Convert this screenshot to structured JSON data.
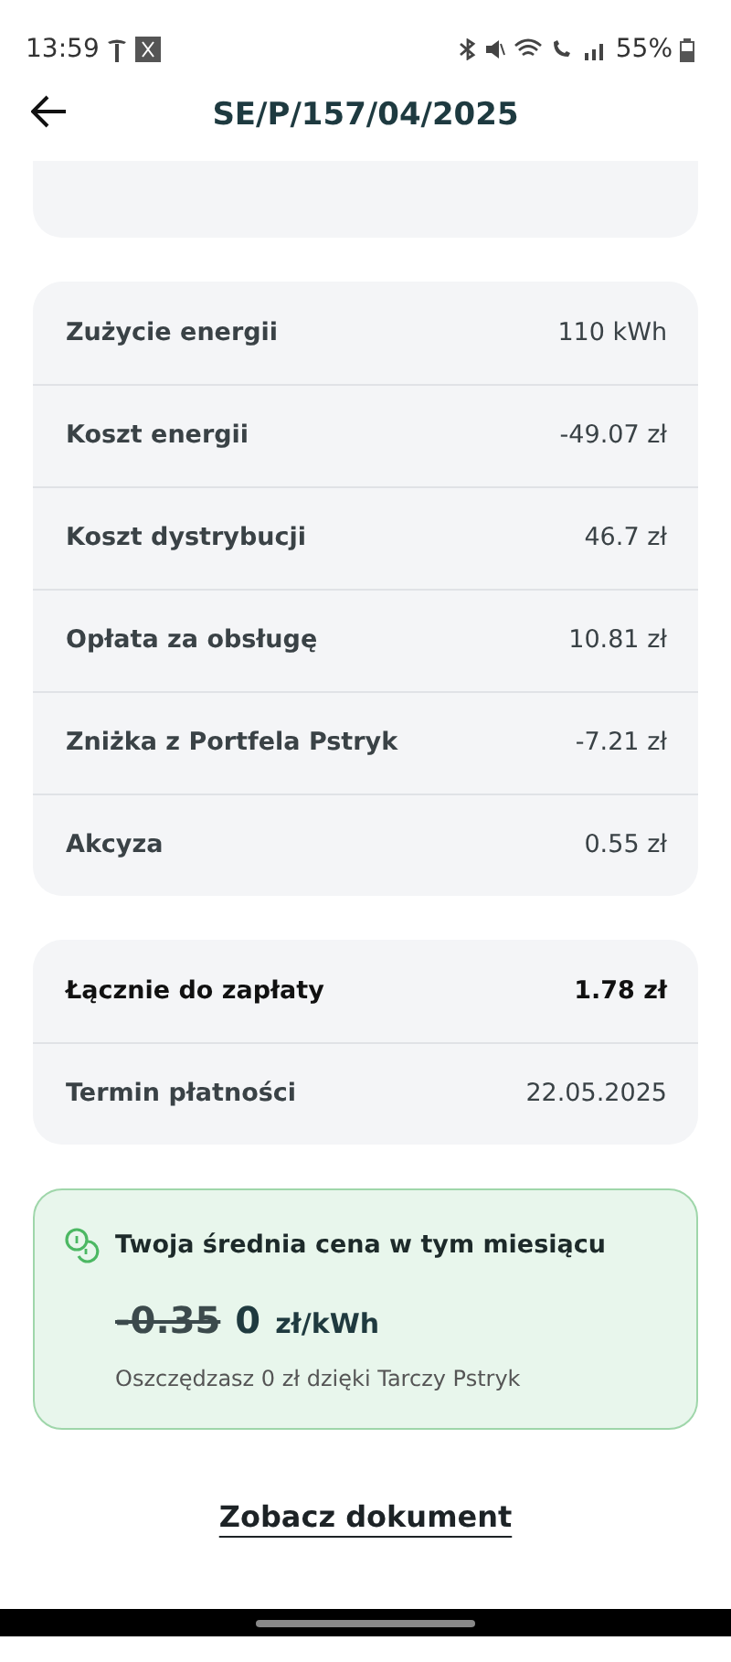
{
  "status_bar": {
    "time": "13:59",
    "battery": "55%"
  },
  "header": {
    "title": "SE/P/157/04/2025"
  },
  "charges": [
    {
      "label": "Zużycie energii",
      "value": "110 kWh"
    },
    {
      "label": "Koszt energii",
      "value": "-49.07 zł"
    },
    {
      "label": "Koszt dystrybucji",
      "value": "46.7 zł"
    },
    {
      "label": "Opłata za obsługę",
      "value": "10.81 zł"
    },
    {
      "label": "Zniżka z Portfela Pstryk",
      "value": "-7.21 zł"
    },
    {
      "label": "Akcyza",
      "value": "0.55 zł"
    }
  ],
  "summary": [
    {
      "label": "Łącznie do zapłaty",
      "value": "1.78 zł",
      "kind": "total"
    },
    {
      "label": "Termin płatności",
      "value": "22.05.2025",
      "kind": "plain"
    }
  ],
  "price_card": {
    "title": "Twoja średnia cena w tym miesiącu",
    "old_price": "-0.35",
    "price": "0",
    "unit": "zł/kWh",
    "note": "Oszczędzasz 0 zł dzięki Tarczy Pstryk"
  },
  "document_link": "Zobacz dokument"
}
